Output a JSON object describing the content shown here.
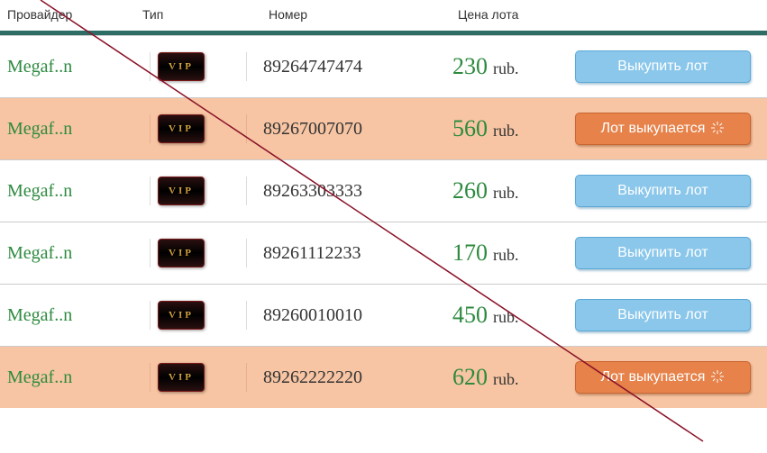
{
  "headers": {
    "provider": "Провайдер",
    "type": "Тип",
    "number": "Номер",
    "price": "Цена лота"
  },
  "vip_label": "VIP",
  "currency": "rub.",
  "buttons": {
    "buy": "Выкупить лот",
    "processing": "Лот выкупается"
  },
  "rows": [
    {
      "provider": "Megaf..n",
      "number": "89264747474",
      "price": "230",
      "state": "buy",
      "highlight": false
    },
    {
      "provider": "Megaf..n",
      "number": "89267007070",
      "price": "560",
      "state": "processing",
      "highlight": true
    },
    {
      "provider": "Megaf..n",
      "number": "89263303333",
      "price": "260",
      "state": "buy",
      "highlight": false
    },
    {
      "provider": "Megaf..n",
      "number": "89261112233",
      "price": "170",
      "state": "buy",
      "highlight": false
    },
    {
      "provider": "Megaf..n",
      "number": "89260010010",
      "price": "450",
      "state": "buy",
      "highlight": false
    },
    {
      "provider": "Megaf..n",
      "number": "89262222220",
      "price": "620",
      "state": "processing",
      "highlight": true
    }
  ],
  "colors": {
    "accent_green": "#2d8a3f",
    "highlight_bg": "#f7c5a3",
    "btn_buy": "#8ac7eb",
    "btn_processing": "#e6824a",
    "divider": "#2e6c66"
  }
}
